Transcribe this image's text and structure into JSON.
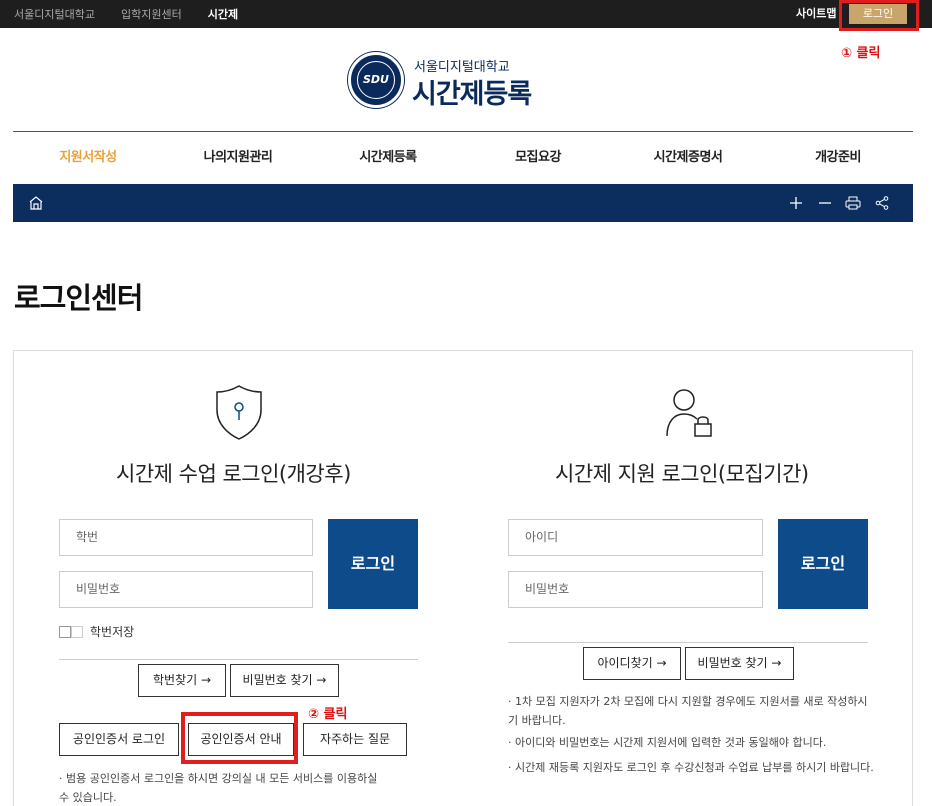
{
  "topbar": {
    "links": [
      "서울디지털대학교",
      "입학지원센터",
      "시간제"
    ],
    "sitemap": "사이트맵",
    "login": "로그인"
  },
  "annotations": {
    "step1": "① 클릭",
    "step2": "② 클릭"
  },
  "logo": {
    "emblem_text": "SDU",
    "subtitle": "서울디지털대학교",
    "title": "시간제등록"
  },
  "nav": [
    "지원서작성",
    "나의지원관리",
    "시간제등록",
    "모집요강",
    "시간제증명서",
    "개강준비"
  ],
  "toolbar_icons": [
    "home-icon",
    "zoom-in-icon",
    "zoom-out-icon",
    "print-icon",
    "share-icon"
  ],
  "page_title": "로그인센터",
  "left": {
    "title": "시간제 수업 로그인(개강후)",
    "id_placeholder": "학번",
    "pw_placeholder": "비밀번호",
    "login": "로그인",
    "save_id": "학번저장",
    "find_id": "학번찾기 →",
    "find_pw": "비밀번호 찾기 →",
    "cert_login": "공인인증서 로그인",
    "cert_guide": "공인인증서 안내",
    "faq": "자주하는 질문",
    "note": "· 범용 공인인증서 로그인을 하시면 강의실 내 모든 서비스를 이용하실 수 있습니다."
  },
  "right": {
    "title": "시간제 지원 로그인(모집기간)",
    "id_placeholder": "아이디",
    "pw_placeholder": "비밀번호",
    "login": "로그인",
    "find_id": "아이디찾기 →",
    "find_pw": "비밀번호 찾기 →",
    "notes": [
      "· 1차 모집 지원자가 2차 모집에 다시 지원할 경우에도 지원서를 새로 작성하시기 바랍니다.",
      "· 아이디와 비밀번호는 시간제 지원서에 입력한 것과 동일해야 합니다.",
      "· 시간제 재등록 지원자도 로그인 후 수강신청과 수업료 납부를 하시기 바랍니다."
    ]
  },
  "colors": {
    "navy": "#0b2e5f",
    "button_blue": "#0d4b8a",
    "accent": "#e8a23a",
    "highlight": "#e01e1e"
  }
}
